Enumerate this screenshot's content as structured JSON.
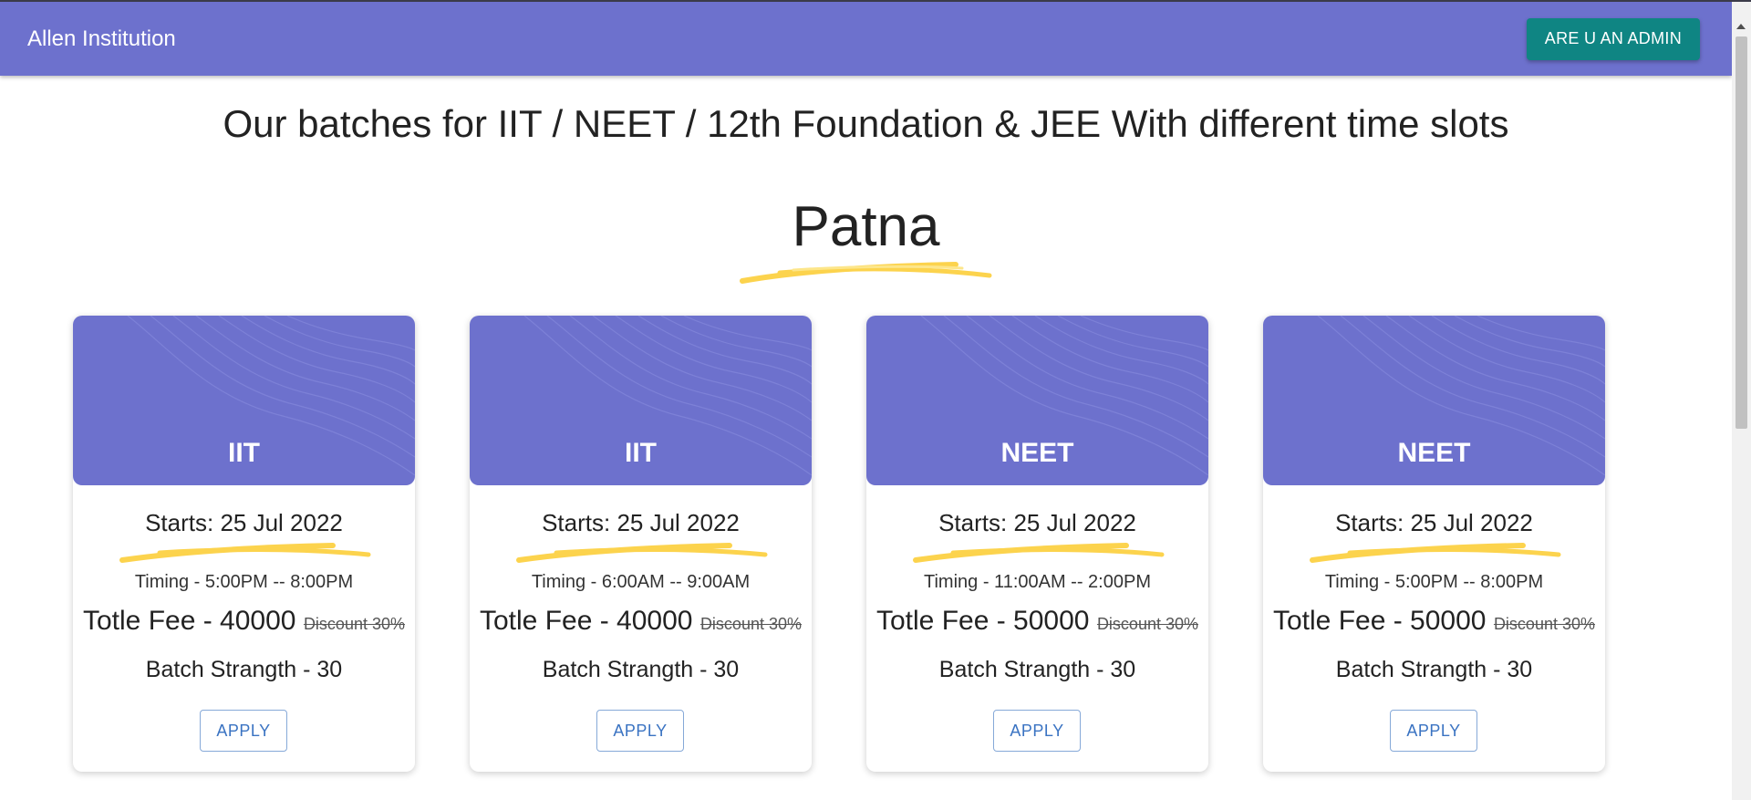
{
  "appbar": {
    "brand": "Allen Institution",
    "admin_button": "ARE U AN ADMIN"
  },
  "headline": "Our batches for IIT / NEET / 12th Foundation & JEE With different time slots",
  "city": "Patna",
  "cards": [
    {
      "title": "IIT",
      "starts": "Starts: 25 Jul 2022",
      "timing": "Timing - 5:00PM -- 8:00PM",
      "fee": "Totle Fee - 40000",
      "discount": "Discount 30%",
      "strength": "Batch Strangth - 30",
      "apply": "APPLY"
    },
    {
      "title": "IIT",
      "starts": "Starts: 25 Jul 2022",
      "timing": "Timing - 6:00AM -- 9:00AM",
      "fee": "Totle Fee - 40000",
      "discount": "Discount 30%",
      "strength": "Batch Strangth - 30",
      "apply": "APPLY"
    },
    {
      "title": "NEET",
      "starts": "Starts: 25 Jul 2022",
      "timing": "Timing - 11:00AM -- 2:00PM",
      "fee": "Totle Fee - 50000",
      "discount": "Discount 30%",
      "strength": "Batch Strangth - 30",
      "apply": "APPLY"
    },
    {
      "title": "NEET",
      "starts": "Starts: 25 Jul 2022",
      "timing": "Timing - 5:00PM -- 8:00PM",
      "fee": "Totle Fee - 50000",
      "discount": "Discount 30%",
      "strength": "Batch Strangth - 30",
      "apply": "APPLY"
    }
  ],
  "colors": {
    "primary": "#6d71cd",
    "admin": "#0f8583",
    "highlight": "#fcd34d",
    "link": "#3a73c2"
  },
  "icons": {
    "underline": "brush-underline-icon",
    "pattern": "wave-pattern-icon"
  }
}
